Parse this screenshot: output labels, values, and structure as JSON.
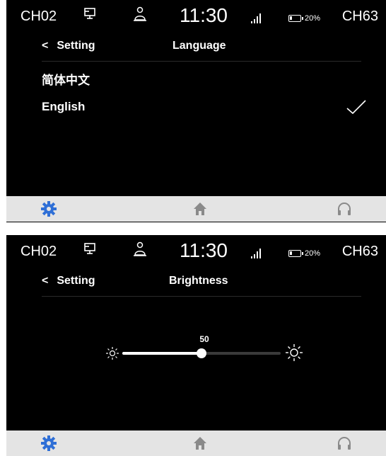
{
  "status_bar": {
    "left_channel": "CH02",
    "time": "11:30",
    "battery": "20%",
    "battery_level": 0.2,
    "right_channel": "CH63",
    "icons": [
      "computer-icon",
      "user-icon",
      "signal-icon",
      "battery-icon"
    ]
  },
  "language_screen": {
    "back_label": "Setting",
    "title": "Language",
    "options": [
      {
        "label": "简体中文",
        "selected": false
      },
      {
        "label": "English",
        "selected": true
      }
    ]
  },
  "brightness_screen": {
    "back_label": "Setting",
    "title": "Brightness",
    "value": "50",
    "level": 0.5
  },
  "bottom_nav": {
    "items": [
      "gear-icon",
      "home-icon",
      "headphones-icon"
    ],
    "active": "gear-icon",
    "colors": {
      "active": "#2f6fd6",
      "inactive": "#8a8a8a",
      "background": "#e4e4e4"
    }
  }
}
